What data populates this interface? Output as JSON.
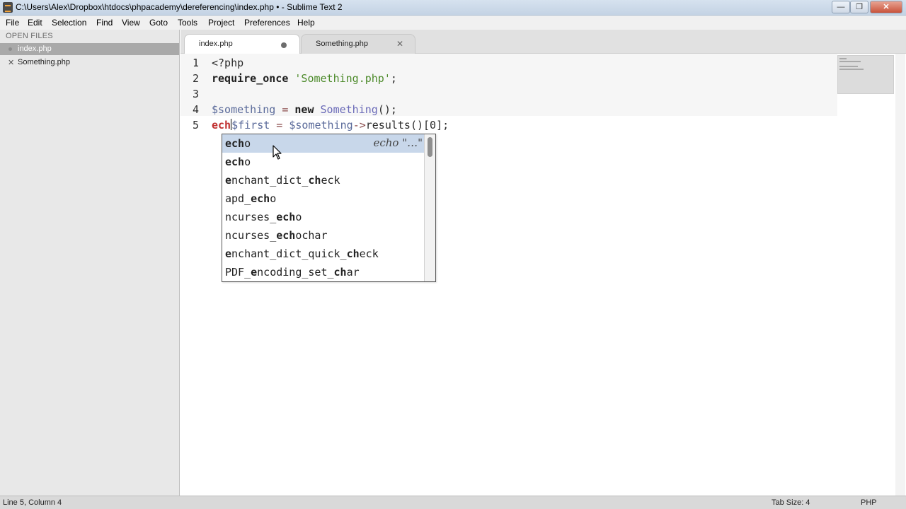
{
  "window": {
    "title": "C:\\Users\\Alex\\Dropbox\\htdocs\\phpacademy\\dereferencing\\index.php • - Sublime Text 2",
    "buttons": {
      "minimize": "—",
      "maximize": "❐",
      "close": "✕"
    }
  },
  "menu": {
    "items": [
      "File",
      "Edit",
      "Selection",
      "Find",
      "View",
      "Goto",
      "Tools",
      "Project",
      "Preferences",
      "Help"
    ]
  },
  "sidebar": {
    "section_title": "OPEN FILES",
    "files": [
      {
        "name": "index.php",
        "active": true,
        "modified": true
      },
      {
        "name": "Something.php",
        "active": false,
        "close_glyph": "✕"
      }
    ]
  },
  "tabs": [
    {
      "label": "index.php",
      "active": true,
      "modified": true
    },
    {
      "label": "Something.php",
      "active": false,
      "close_glyph": "✕"
    }
  ],
  "editor": {
    "line_numbers": [
      "1",
      "2",
      "3",
      "4",
      "5"
    ],
    "lines": [
      [
        "<?php"
      ],
      [
        "require_once",
        " ",
        "'Something.php'",
        ";"
      ],
      [
        ""
      ],
      [
        "$something",
        " = ",
        "new",
        " ",
        "Something",
        "();"
      ],
      [
        "ech",
        "$first",
        " = ",
        "$something",
        "->",
        "results()[0];"
      ]
    ]
  },
  "autocomplete": {
    "items": [
      {
        "match": "ech",
        "rest": "o",
        "hint": "echo \"…\"",
        "selected": true
      },
      {
        "match": "ech",
        "rest": "o"
      },
      {
        "pre": "",
        "parts": [
          "e",
          "nchant_dict_",
          "ch",
          "eck"
        ]
      },
      {
        "parts": [
          "apd_",
          "ech",
          "o"
        ]
      },
      {
        "parts": [
          "ncurses_",
          "ech",
          "o"
        ]
      },
      {
        "parts": [
          "ncurses_",
          "ech",
          "ochar"
        ]
      },
      {
        "parts": [
          "e",
          "nchant_dict_quick_",
          "ch",
          "eck"
        ]
      },
      {
        "parts": [
          "PDF_",
          "e",
          "ncoding_set_",
          "ch",
          "ar"
        ]
      }
    ]
  },
  "status": {
    "position": "Line 5, Column 4",
    "tab_size": "Tab Size: 4",
    "syntax": "PHP"
  },
  "colors": {
    "string": "#4c8a2a",
    "selection": "#c8d7ea",
    "typed": "#c03030"
  },
  "icons": {
    "app": "sublime-text-icon",
    "modified": "dot-icon",
    "close": "close-icon",
    "pointer": "mouse-pointer-icon"
  }
}
